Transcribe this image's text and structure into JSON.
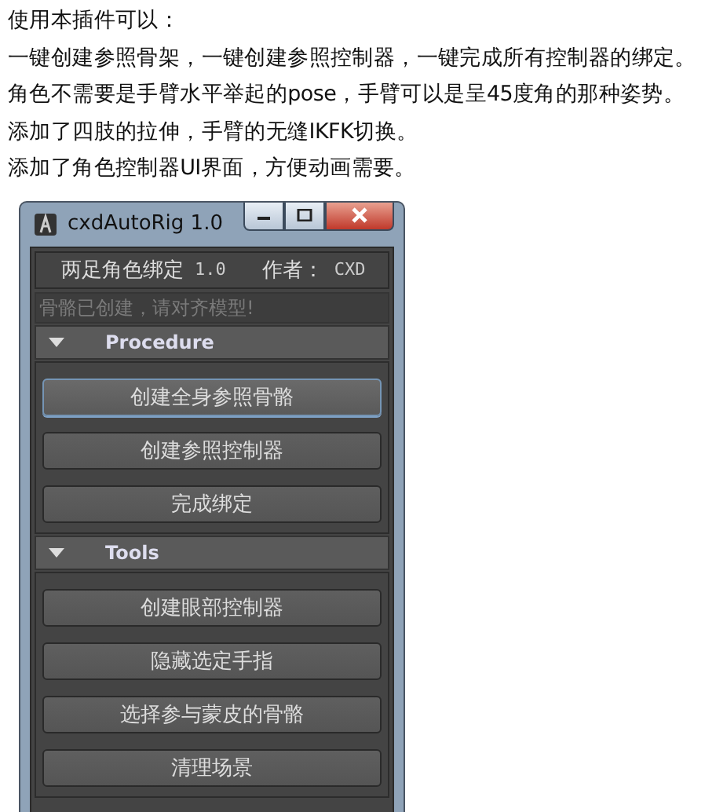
{
  "intro": [
    "使用本插件可以：",
    "一键创建参照骨架，一键创建参照控制器，一键完成所有控制器的绑定。",
    "角色不需要是手臂水平举起的pose，手臂可以是呈45度角的那种姿势。",
    "添加了四肢的拉伸，手臂的无缝IKFK切换。",
    "添加了角色控制器UI界面，方便动画需要。"
  ],
  "window": {
    "title": "cxdAutoRig 1.0",
    "header": {
      "name": "两足角色绑定",
      "version": "1.0",
      "author_label": "作者：",
      "author": "CXD"
    },
    "status": {
      "placeholder": "骨骼已创建，请对齐模型!"
    },
    "sections": [
      {
        "title": "Procedure",
        "expanded": true,
        "buttons": [
          {
            "label": "创建全身参照骨骼",
            "selected": true
          },
          {
            "label": "创建参照控制器",
            "selected": false
          },
          {
            "label": "完成绑定",
            "selected": false
          }
        ]
      },
      {
        "title": "Tools",
        "expanded": true,
        "buttons": [
          {
            "label": "创建眼部控制器",
            "selected": false
          },
          {
            "label": "隐藏选定手指",
            "selected": false
          },
          {
            "label": "选择参与蒙皮的骨骼",
            "selected": false
          },
          {
            "label": "清理场景",
            "selected": false
          }
        ]
      }
    ]
  }
}
